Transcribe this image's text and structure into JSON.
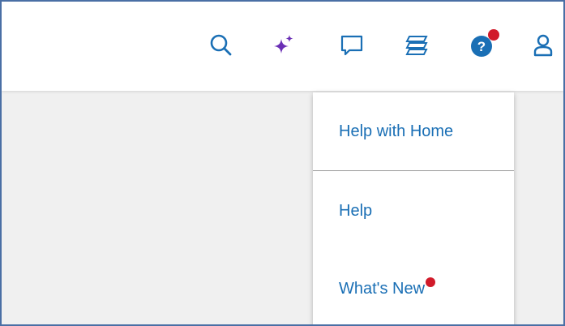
{
  "header": {
    "icons": {
      "search": "search-icon",
      "ai_sparkle": "sparkle-icon",
      "chat": "chat-icon",
      "layers": "layers-icon",
      "help": "help-icon",
      "user": "user-icon"
    },
    "help_badge_color": "#d11a2a"
  },
  "help_menu": {
    "items": [
      {
        "label": "Help with Home"
      },
      {
        "label": "Help"
      },
      {
        "label": "What's New"
      }
    ],
    "new_badge_color": "#d11a2a"
  },
  "colors": {
    "accent": "#1a6fb5",
    "sparkle": "#6a2fb5",
    "frame_border": "#4a6fa5"
  }
}
